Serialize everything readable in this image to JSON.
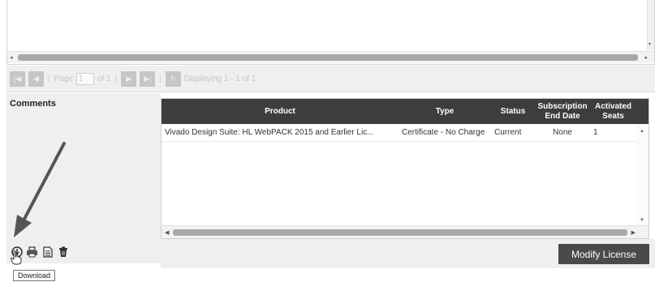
{
  "top_grid": {
    "hscroll_left": "◂",
    "hscroll_right": "▸",
    "vscroll_down": "▾"
  },
  "pager": {
    "first_icon": "first-page-icon",
    "prev_icon": "prev-page-icon",
    "page_label": "Page",
    "page_value": "1",
    "of_label": "of 1",
    "next_icon": "next-page-icon",
    "last_icon": "last-page-icon",
    "refresh_icon": "refresh-icon",
    "displaying": "Displaying 1 - 1 of 1"
  },
  "comments": {
    "title": "Comments"
  },
  "product_grid": {
    "columns": [
      "Product",
      "Type",
      "Status",
      "Subscription End Date",
      "Activated Seats"
    ],
    "rows": [
      {
        "product": "Vivado Design Suite: HL WebPACK 2015 and Earlier Lic...",
        "type": "Certificate - No Charge",
        "status": "Current",
        "end_date": "None",
        "seats": "1"
      }
    ]
  },
  "actions": {
    "modify_label": "Modify License",
    "icons": [
      "download-icon",
      "print-icon",
      "document-icon",
      "delete-icon"
    ]
  },
  "tooltip": {
    "text": "Download"
  }
}
